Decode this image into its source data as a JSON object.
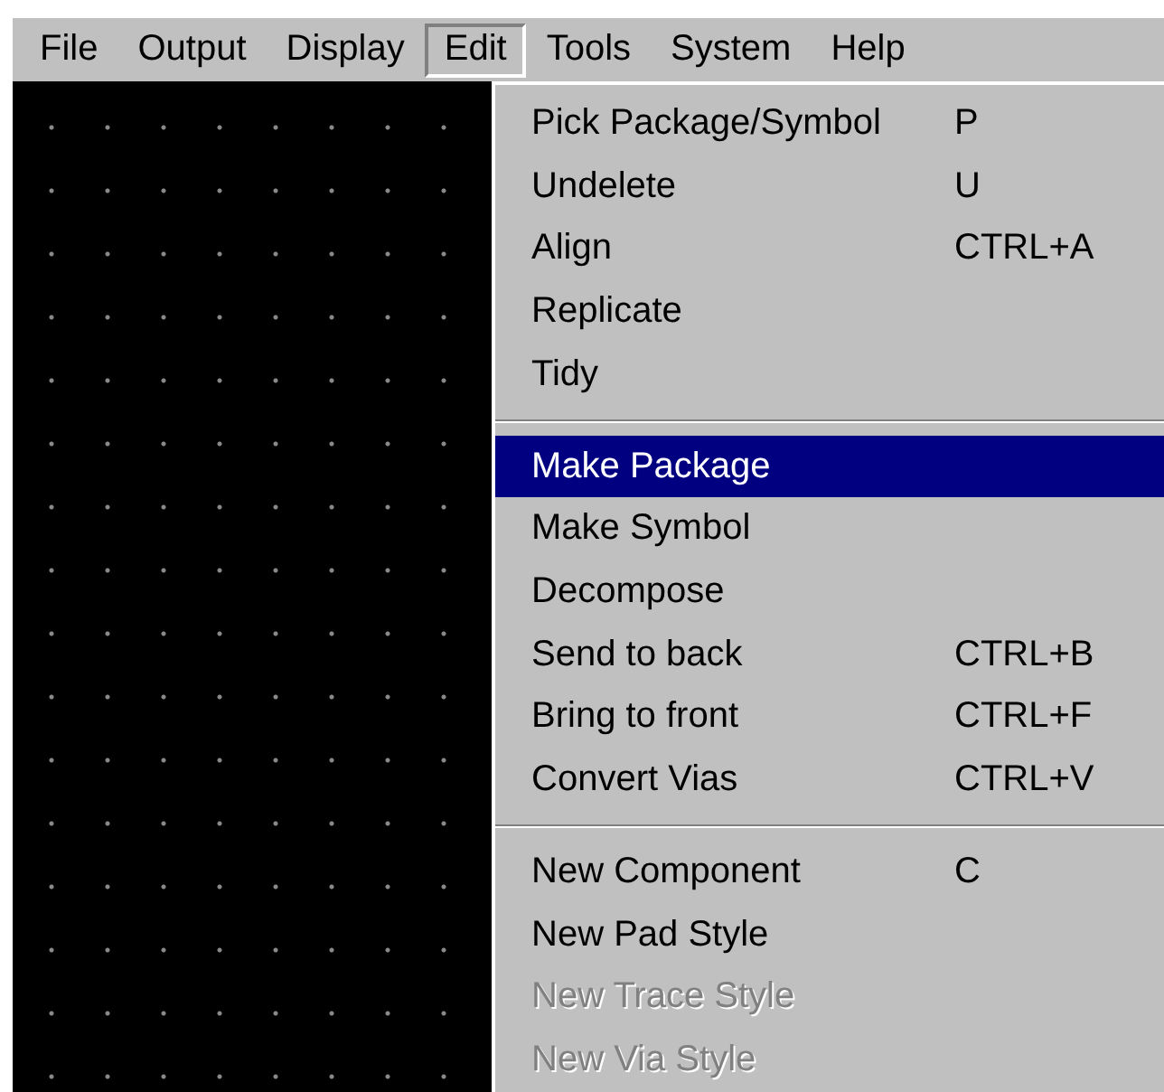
{
  "menu_bar": [
    {
      "label": "File",
      "selected": false
    },
    {
      "label": "Output",
      "selected": false
    },
    {
      "label": "Display",
      "selected": false
    },
    {
      "label": "Edit",
      "selected": true
    },
    {
      "label": "Tools",
      "selected": false
    },
    {
      "label": "System",
      "selected": false
    },
    {
      "label": "Help",
      "selected": false
    }
  ],
  "edit_menu": {
    "groups": [
      [
        {
          "label": "Pick Package/Symbol",
          "shortcut": "P",
          "selected": false,
          "disabled": false
        },
        {
          "label": "Undelete",
          "shortcut": "U",
          "selected": false,
          "disabled": false
        },
        {
          "label": "Align",
          "shortcut": "CTRL+A",
          "selected": false,
          "disabled": false
        },
        {
          "label": "Replicate",
          "selected": false,
          "disabled": false
        },
        {
          "label": "Tidy",
          "selected": false,
          "disabled": false
        }
      ],
      [
        {
          "label": "Make Package",
          "selected": true,
          "disabled": false
        },
        {
          "label": "Make Symbol",
          "selected": false,
          "disabled": false
        },
        {
          "label": "Decompose",
          "selected": false,
          "disabled": false
        },
        {
          "label": "Send to back",
          "shortcut": "CTRL+B",
          "selected": false,
          "disabled": false
        },
        {
          "label": "Bring to front",
          "shortcut": "CTRL+F",
          "selected": false,
          "disabled": false
        },
        {
          "label": "Convert Vias",
          "shortcut": "CTRL+V",
          "selected": false,
          "disabled": false
        }
      ],
      [
        {
          "label": "New Component",
          "shortcut": "C",
          "selected": false,
          "disabled": false
        },
        {
          "label": "New Pad Style",
          "selected": false,
          "disabled": false
        },
        {
          "label": "New Trace Style",
          "selected": false,
          "disabled": true
        },
        {
          "label": "New Via Style",
          "selected": false,
          "disabled": true
        }
      ]
    ]
  }
}
